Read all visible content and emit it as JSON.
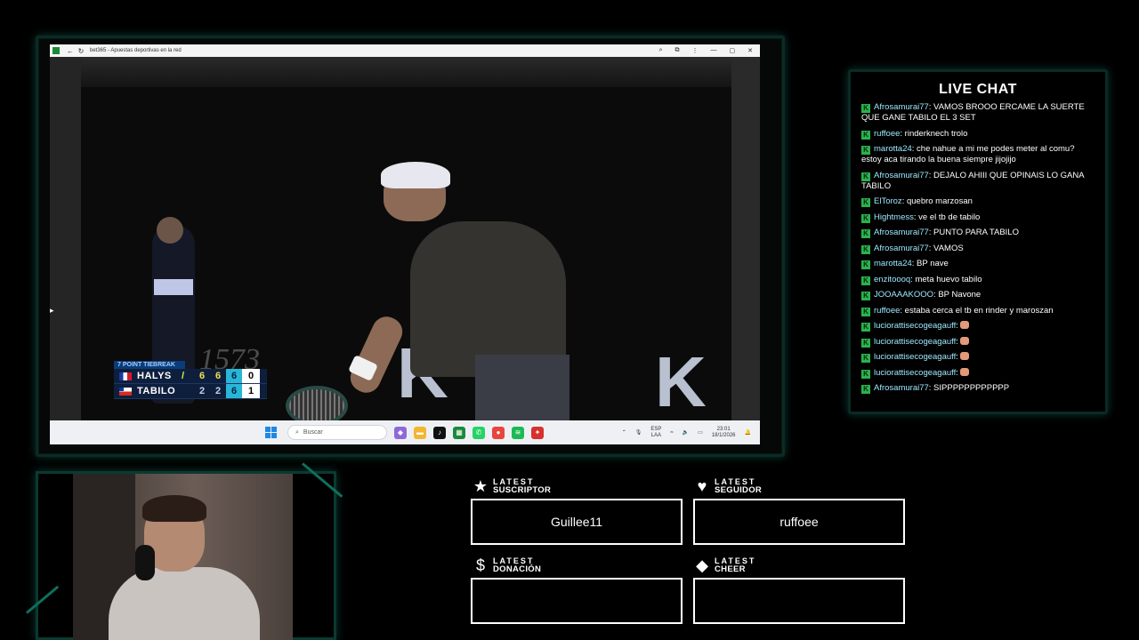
{
  "browser": {
    "tab_title": "bet365 - Apuestas deportivas en la red"
  },
  "scoreboard": {
    "caption": "7 POINT TIEBREAK",
    "players": [
      {
        "name": "HALYS",
        "serving": true,
        "set1": "6",
        "set2": "6",
        "set3": "6",
        "points": "0",
        "flag": "france"
      },
      {
        "name": "TABILO",
        "serving": false,
        "set1": "2",
        "set2": "2",
        "set3": "6",
        "points": "1",
        "flag": "chile"
      }
    ]
  },
  "sponsor_text": "1573",
  "taskbar": {
    "search_placeholder": "Buscar",
    "lang_line1": "ESP",
    "lang_line2": "LAA",
    "time": "23:01",
    "date": "18/1/2026"
  },
  "chat": {
    "title": "LIVE CHAT",
    "messages": [
      {
        "user": "Afrosamurai77",
        "text": ": VAMOS BROOO ERCAME LA SUERTE QUE GANE TABILO EL 3 SET"
      },
      {
        "user": "ruffoee",
        "text": ": rinderknech trolo"
      },
      {
        "user": "marotta24",
        "text": ": che nahue a mi me podes meter al comu? estoy aca tirando la buena siempre jijojijo"
      },
      {
        "user": "Afrosamurai77",
        "text": ": DEJALO AHIII QUE OPINAIS LO GANA TABILO"
      },
      {
        "user": "ElToroz",
        "text": ": quebro marzosan"
      },
      {
        "user": "Hightmess",
        "text": ": ve el tb de tabilo"
      },
      {
        "user": "Afrosamurai77",
        "text": ": PUNTO PARA TABILO"
      },
      {
        "user": "Afrosamurai77",
        "text": ": VAMOS"
      },
      {
        "user": "marotta24",
        "text": ": BP nave"
      },
      {
        "user": "enzitoooq",
        "text": ": meta huevo tabilo"
      },
      {
        "user": "JOOAAAKOOO",
        "text": ": BP Navone"
      },
      {
        "user": "ruffoee",
        "text": ": estaba cerca el tb en rinder y maroszan"
      },
      {
        "user": "luciorattisecogeagauff",
        "text": ":",
        "emote": true
      },
      {
        "user": "luciorattisecogeagauff",
        "text": ":",
        "emote": true
      },
      {
        "user": "luciorattisecogeagauff",
        "text": ":",
        "emote": true
      },
      {
        "user": "luciorattisecogeagauff",
        "text": ":",
        "emote": true
      },
      {
        "user": "Afrosamurai77",
        "text": ": SIPPPPPPPPPPPP"
      }
    ]
  },
  "widgets": {
    "subscriber": {
      "label_top": "LATEST",
      "label_bottom": "SUSCRIPTOR",
      "value": "Guillee11"
    },
    "follower": {
      "label_top": "LATEST",
      "label_bottom": "SEGUIDOR",
      "value": "ruffoee"
    },
    "donation": {
      "label_top": "LATEST",
      "label_bottom": "DONACIÓN",
      "value": ""
    },
    "cheer": {
      "label_top": "LATEST",
      "label_bottom": "CHEER",
      "value": ""
    }
  },
  "colors": {
    "frame_accent": "#0b2a24",
    "chat_username": "#9ee8ff",
    "chat_badge": "#2bb24c"
  }
}
